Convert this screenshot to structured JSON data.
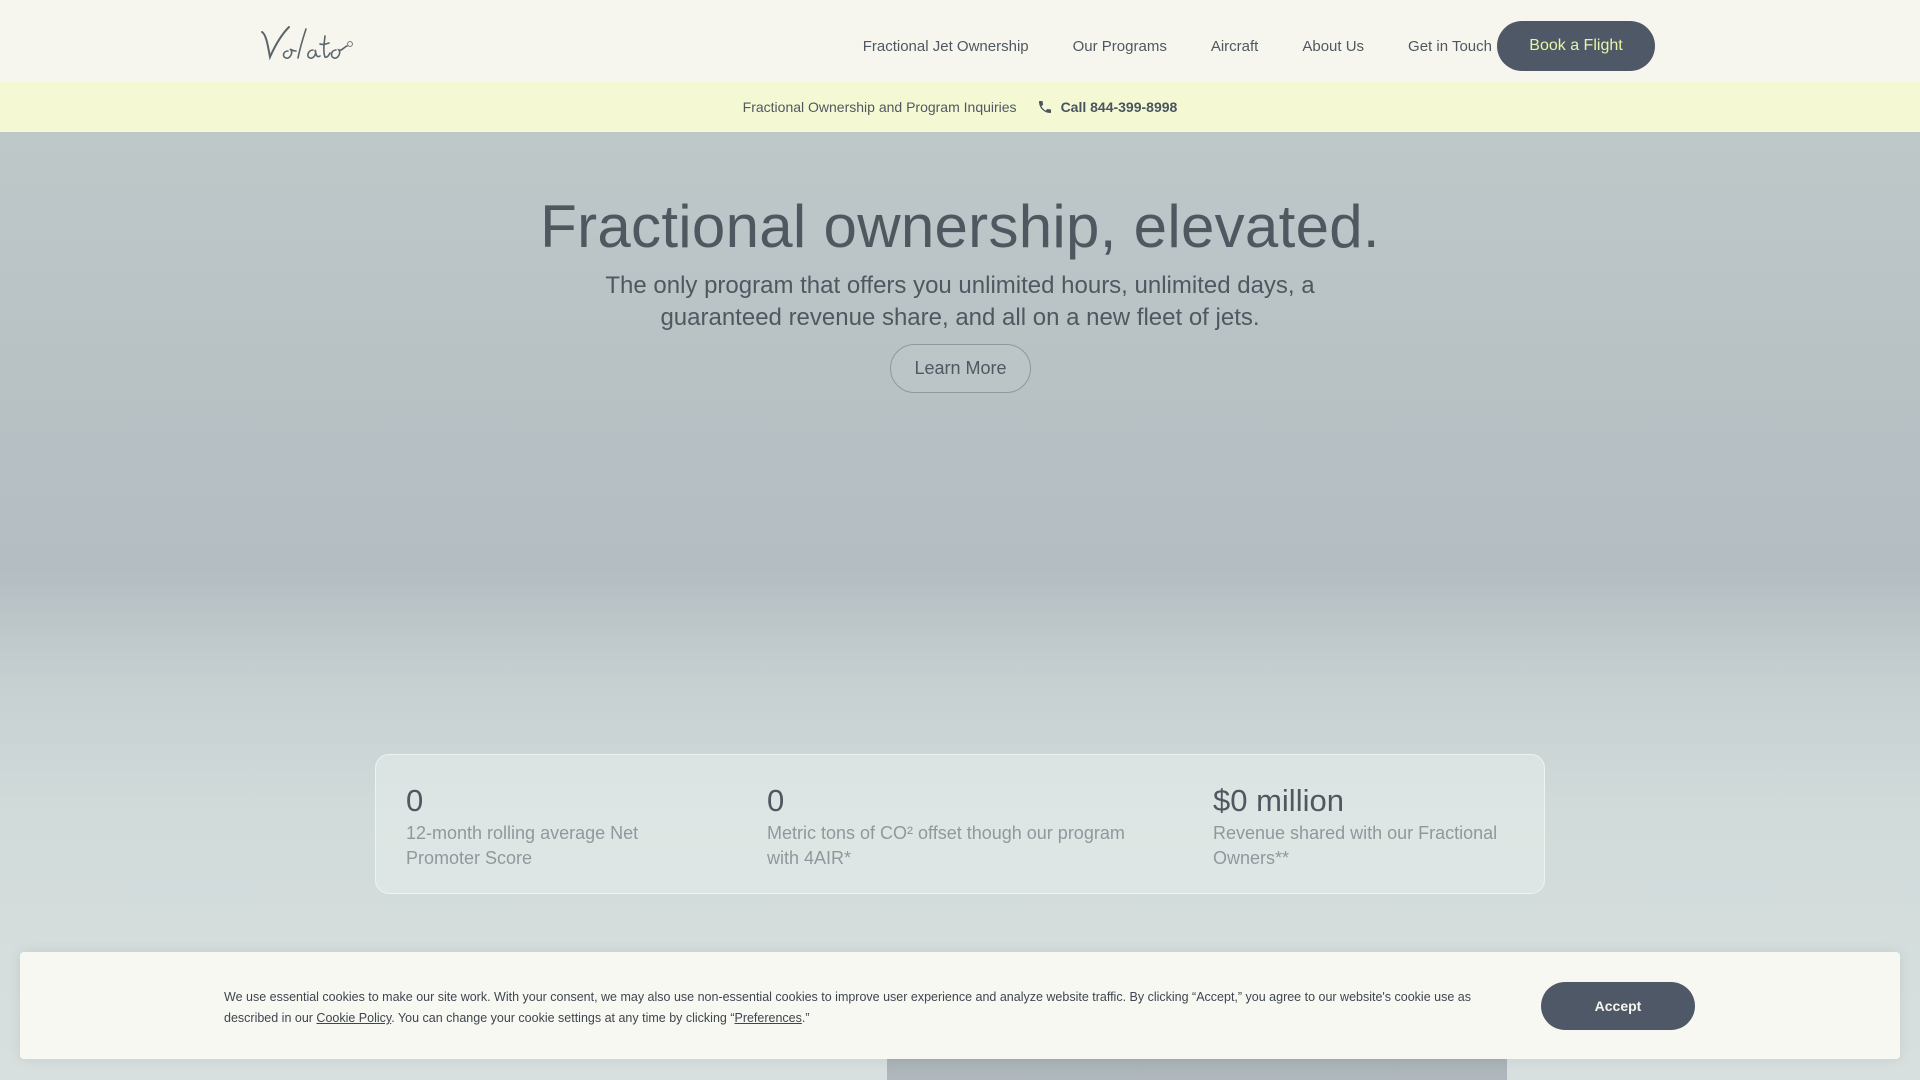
{
  "header": {
    "logo_text": "Volato",
    "nav": [
      {
        "label": "Fractional Jet Ownership"
      },
      {
        "label": "Our Programs"
      },
      {
        "label": "Aircraft"
      },
      {
        "label": "About Us"
      },
      {
        "label": "Get in Touch"
      }
    ],
    "cta_label": "Book a Flight"
  },
  "announcement": {
    "text": "Fractional Ownership and Program Inquiries",
    "phone_label": "Call 844-399-8998"
  },
  "hero": {
    "title": "Fractional ownership, elevated.",
    "subtitle": "The only program that offers you unlimited hours, unlimited days, a guaranteed revenue share, and all on a new fleet of jets.",
    "button_label": "Learn More"
  },
  "stats": [
    {
      "value": "0",
      "description": "12-month rolling average Net Promoter Score"
    },
    {
      "value": "0",
      "description": "Metric tons of CO² offset though our program with 4AIR*"
    },
    {
      "value": "$0 million",
      "description": "Revenue shared with our Fractional Owners**"
    }
  ],
  "cookie": {
    "text_part1": "We use essential cookies to make our site work. With your consent, we may also use non-essential cookies to improve user experience and analyze website traffic. By clicking “Accept,” you agree to our website's cookie use as described in our ",
    "cookie_policy_link": "Cookie Policy",
    "text_part2": ". You can change your cookie settings at any time by clicking “",
    "preferences_link": "Preferences",
    "text_part3": ".”",
    "accept_label": "Accept"
  },
  "colors": {
    "background": "#f6f6ef",
    "announcement_bg": "#f4f9d3",
    "primary_button": "#4f5866",
    "cta_text": "#e7f5a8",
    "text": "#4f5860"
  }
}
